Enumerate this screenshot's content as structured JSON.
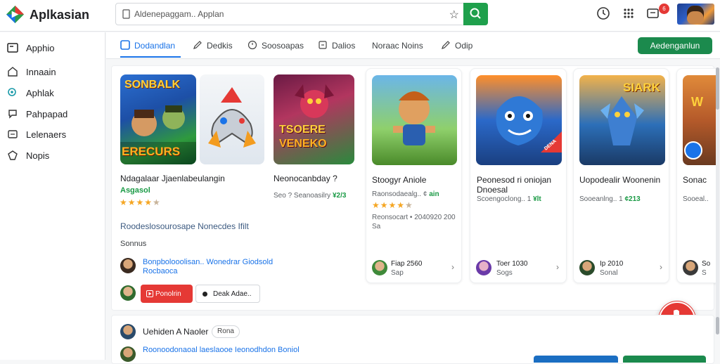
{
  "app": {
    "title": "Aplkasian"
  },
  "search": {
    "value": "Aldenepaggam.. Applan",
    "placeholder": "Aldenepaggam.. Applan"
  },
  "header": {
    "notification_count": "6"
  },
  "sidebar": {
    "items": [
      {
        "label": "Apphio",
        "icon": "app-window-icon",
        "active": true
      },
      {
        "label": "Innaain",
        "icon": "home-icon"
      },
      {
        "label": "Aphlak",
        "icon": "search-icon"
      },
      {
        "label": "Pahpapad",
        "icon": "chat-icon"
      },
      {
        "label": "Lelenaers",
        "icon": "inbox-icon"
      },
      {
        "label": "Nopis",
        "icon": "shield-icon"
      }
    ]
  },
  "tabs": [
    {
      "label": "Dodandlan",
      "icon": "square-icon",
      "active": true
    },
    {
      "label": "Dedkis",
      "icon": "pen-icon"
    },
    {
      "label": "Soosoapas",
      "icon": "clock-icon"
    },
    {
      "label": "Dalios",
      "icon": "box-icon"
    },
    {
      "label": "Noraac Noins",
      "icon": ""
    },
    {
      "label": "Odip",
      "icon": "pen-icon"
    }
  ],
  "cta": {
    "label": "Aedenganlun"
  },
  "featured": {
    "title": "Ndagalaar Jjaenlabeulangin",
    "price": "Asgasol",
    "rating": 4,
    "description": "Roodeslosourosape Nonecdes Ifilt",
    "section_label": "Sonnus",
    "author_line1": "Bonpbolooolisan.. Wonedrar Giodsold",
    "author_line2": "Rocbaoca",
    "thumb1_line1": "SONBALK",
    "thumb1_line2": "ERECURS",
    "primary_button": "Ponolrin",
    "secondary_button": "Deak Adae.."
  },
  "cards": [
    {
      "title": "Neonocanbday ?",
      "meta": "Seo ? Seanoasilry",
      "price": "¥2/3",
      "art_line1": "TSOERE",
      "art_line2": "VENEKO"
    },
    {
      "title": "Stoogyr Aniole",
      "meta": "Raonsodaealg.. ¢",
      "price": "ain",
      "rating": 4,
      "detail": "Reonsocart • 2040920 200",
      "detail2": "Sa",
      "author": "Fiap 2560",
      "author_sub": "Sap"
    },
    {
      "title": "Peonesod ri oniojan",
      "title2": "Dnoesal",
      "meta": "Scoengoclong.. 1",
      "price": "¥lt",
      "author": "Toer 1030",
      "author_sub": "Sogs",
      "badge": "DENA"
    },
    {
      "title": "Uopodealir Woonenin",
      "meta": "Sooeanlng.. 1",
      "price": "¢213",
      "art_line1": "SIARK",
      "author": "Ip 2010",
      "author_sub": "Sonal"
    },
    {
      "title": "Sonac",
      "meta": "Sooeal..",
      "author": "So",
      "author_sub": "S",
      "art_line1": "W"
    }
  ],
  "lower": {
    "title": "Uehiden A Naoler",
    "pill": "Rona",
    "line": "Roonoodonaoal laeslaooe Ieonodhdon Boniol"
  },
  "colors": {
    "accent": "#1a73e8",
    "brand_green": "#1b8a4d",
    "danger": "#e53935",
    "star": "#f5a623"
  }
}
